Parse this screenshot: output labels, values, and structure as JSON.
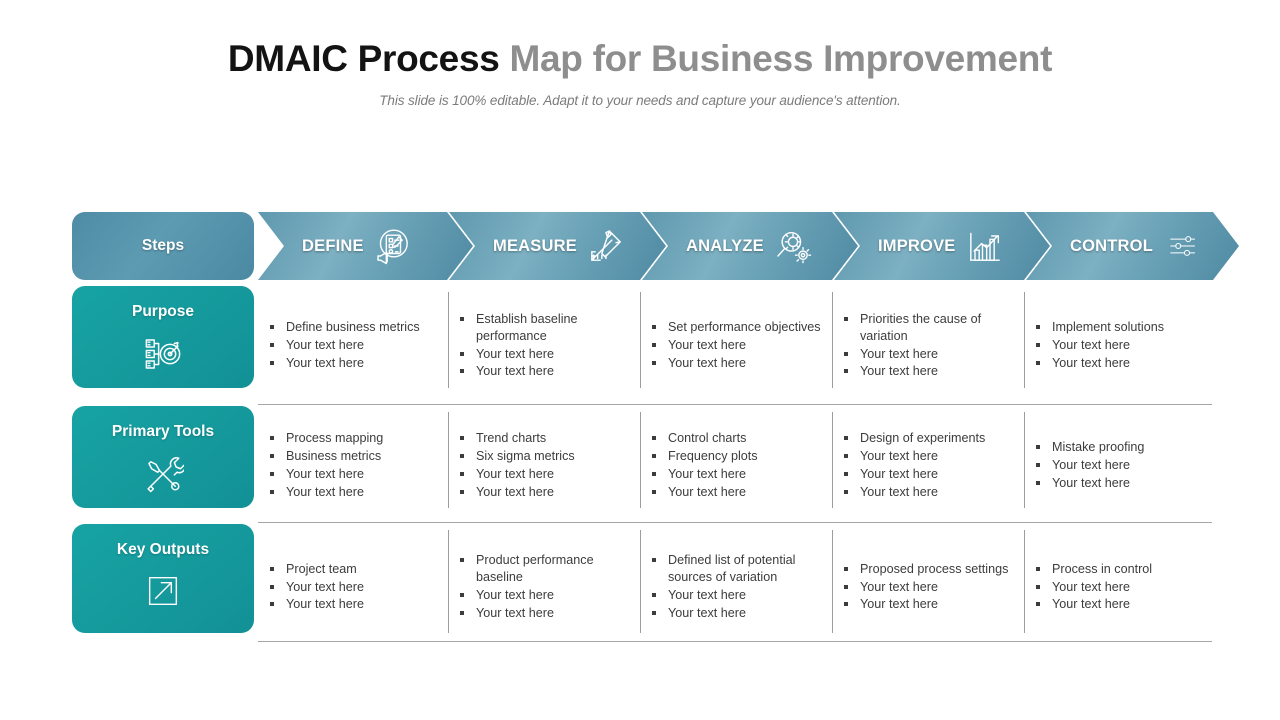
{
  "title": {
    "dark_part": "DMAIC Process ",
    "grey_part": "Map for Business Improvement",
    "subtitle": "This slide is 100% editable. Adapt it to your needs and capture your audience's attention."
  },
  "colors": {
    "steps_blue": "#4e8ca6",
    "chevron_blue": "#6ba3b8",
    "row_label_teal": "#15999c",
    "body_text": "#3c3c3c",
    "title_dark": "#131313",
    "title_grey": "#8e8e8e",
    "grid_line": "#a6a6a6"
  },
  "header": {
    "steps_label": "Steps",
    "phases": [
      {
        "label": "DEFINE",
        "icon": "clipboard-checklist-megaphone-icon"
      },
      {
        "label": "MEASURE",
        "icon": "ruler-pencil-icon"
      },
      {
        "label": "ANALYZE",
        "icon": "magnifier-gear-icon"
      },
      {
        "label": "IMPROVE",
        "icon": "bar-chart-arrow-icon"
      },
      {
        "label": "CONTROL",
        "icon": "sliders-icon"
      }
    ]
  },
  "rows": [
    {
      "label": "Purpose",
      "icon": "hierarchy-target-icon",
      "cells": [
        [
          "Define business metrics",
          "Your text here",
          "Your text here"
        ],
        [
          "Establish baseline performance",
          "Your text here",
          "Your text here"
        ],
        [
          "Set performance objectives",
          "Your text here",
          "Your text here"
        ],
        [
          "Priorities the cause of variation",
          "Your text here",
          "Your text here"
        ],
        [
          "Implement solutions",
          "Your text here",
          "Your text here"
        ]
      ]
    },
    {
      "label": "Primary Tools",
      "icon": "wrench-screwdriver-icon",
      "cells": [
        [
          "Process mapping",
          "Business metrics",
          "Your text here",
          "Your text here"
        ],
        [
          "Trend charts",
          "Six sigma metrics",
          "Your text here",
          "Your text here"
        ],
        [
          "Control charts",
          "Frequency plots",
          "Your text here",
          "Your text here"
        ],
        [
          "Design of experiments",
          "Your text here",
          "Your text here",
          "Your text here"
        ],
        [
          "Mistake proofing",
          "Your text here",
          "Your text here"
        ]
      ]
    },
    {
      "label": "Key Outputs",
      "icon": "arrow-out-of-box-icon",
      "cells": [
        [
          "Project team",
          "Your text here",
          "Your text here"
        ],
        [
          "Product performance baseline",
          "Your text here",
          "Your text here"
        ],
        [
          "Defined list of potential sources of variation",
          "Your text here",
          "Your text here"
        ],
        [
          "Proposed process settings",
          "Your text here",
          "Your text here"
        ],
        [
          "Process in control",
          "Your text here",
          "Your text here"
        ]
      ]
    }
  ]
}
